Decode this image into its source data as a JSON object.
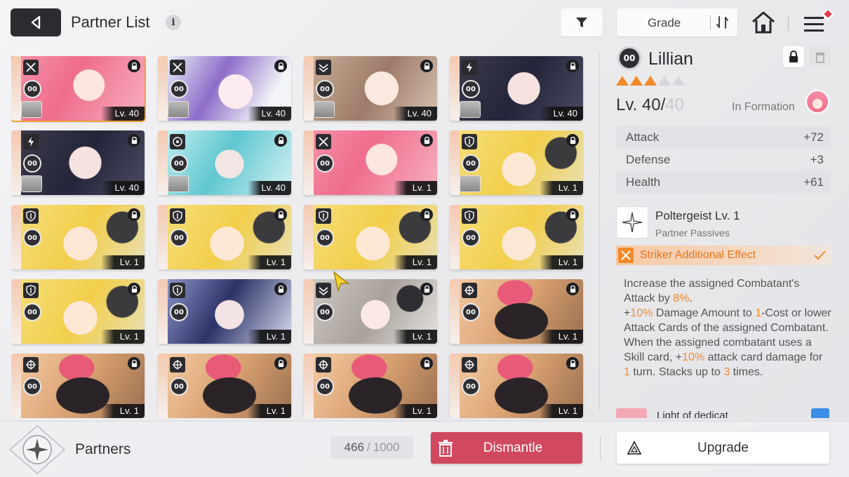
{
  "header": {
    "title": "Partner List",
    "info_glyph": "i",
    "grade_label": "Grade"
  },
  "cards": [
    {
      "level": "Lv. 40",
      "style": "hair-pink",
      "cls": "striker",
      "selected": true,
      "sub": true
    },
    {
      "level": "Lv. 40",
      "style": "hair-purple",
      "cls": "striker",
      "sub": true
    },
    {
      "level": "Lv. 40",
      "style": "hair-brown",
      "cls": "vanguard",
      "sub": true
    },
    {
      "level": "Lv. 40",
      "style": "hair-dark",
      "cls": "lightning",
      "sub": true
    },
    {
      "level": "Lv. 40",
      "style": "hair-dark",
      "cls": "lightning",
      "sub": true
    },
    {
      "level": "Lv. 40",
      "style": "hair-teal",
      "cls": "target",
      "sub": true
    },
    {
      "level": "Lv. 1",
      "style": "hair-pink",
      "cls": "striker"
    },
    {
      "level": "Lv. 1",
      "style": "hair-blonde",
      "cls": "shield",
      "sub": true
    },
    {
      "level": "Lv. 1",
      "style": "hair-blonde",
      "cls": "shield"
    },
    {
      "level": "Lv. 1",
      "style": "hair-blonde",
      "cls": "shield"
    },
    {
      "level": "Lv. 1",
      "style": "hair-blonde",
      "cls": "shield"
    },
    {
      "level": "Lv. 1",
      "style": "hair-blonde",
      "cls": "shield"
    },
    {
      "level": "Lv. 1",
      "style": "hair-blonde",
      "cls": "shield"
    },
    {
      "level": "Lv. 1",
      "style": "hair-navy",
      "cls": "shield"
    },
    {
      "level": "Lv. 1",
      "style": "hair-ash",
      "cls": "vanguard"
    },
    {
      "level": "Lv. 1",
      "style": "hair-blob",
      "cls": "crosshair"
    },
    {
      "level": "Lv. 1",
      "style": "hair-blob",
      "cls": "crosshair"
    },
    {
      "level": "Lv. 1",
      "style": "hair-blob",
      "cls": "crosshair"
    },
    {
      "level": "Lv. 1",
      "style": "hair-blob",
      "cls": "crosshair"
    },
    {
      "level": "Lv. 1",
      "style": "hair-blob",
      "cls": "crosshair"
    }
  ],
  "card_ring_label": "00",
  "detail": {
    "ring_label": "00",
    "name": "Lillian",
    "stars_on": 3,
    "stars_total": 5,
    "level_current": "Lv. 40/",
    "level_max": "40",
    "formation": "In Formation",
    "stats": [
      {
        "label": "Attack",
        "value": "+72"
      },
      {
        "label": "Defense",
        "value": "+3"
      },
      {
        "label": "Health",
        "value": "+61"
      }
    ],
    "passive_name": "Poltergeist Lv. 1",
    "passive_sub": "Partner Passives",
    "striker_label": "Striker Additional Effect",
    "desc_1a": "Increase the assigned Combatant's Attack by ",
    "desc_1b": "8%",
    "desc_1c": ".",
    "desc_2a": "+",
    "desc_2b": "10%",
    "desc_2c": " Damage Amount to ",
    "desc_2d": "1",
    "desc_2e": "-Cost or lower Attack Cards of the assigned Combatant.",
    "desc_3a": "When the assigned combatant uses a Skill card, +",
    "desc_3b": "10%",
    "desc_3c": " attack card damage for ",
    "desc_3d": "1",
    "desc_3e": " turn. Stacks up to ",
    "desc_3f": "3",
    "desc_3g": " times.",
    "peek_text": "Light of dedicat"
  },
  "footer": {
    "label": "Partners",
    "count": "466",
    "slash": "/",
    "max": "1000",
    "dismantle_label": "Dismantle",
    "upgrade_label": "Upgrade"
  },
  "colors": {
    "accent": "#f08a2a",
    "dismantle": "#d0495e",
    "selected_outline": "#f0a233"
  }
}
